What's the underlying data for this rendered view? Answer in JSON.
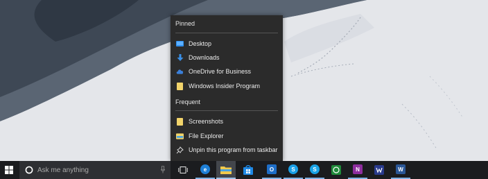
{
  "jumplist": {
    "pinned_label": "Pinned",
    "frequent_label": "Frequent",
    "pinned": [
      {
        "label": "Desktop",
        "icon": "desktop-folder-icon",
        "color": "#2f8ff0"
      },
      {
        "label": "Downloads",
        "icon": "downloads-icon",
        "color": "#3a8fe6"
      },
      {
        "label": "OneDrive for Business",
        "icon": "onedrive-icon",
        "color": "#3b7fd9"
      },
      {
        "label": "Windows Insider Program",
        "icon": "folder-icon",
        "color": "#f2d46b"
      }
    ],
    "frequent": [
      {
        "label": "Screenshots",
        "icon": "folder-icon",
        "color": "#f2d46b"
      },
      {
        "label": "File Explorer",
        "icon": "file-explorer-icon",
        "color": "#f2d46b"
      }
    ],
    "unpin_label": "Unpin this program from taskbar"
  },
  "taskbar": {
    "search_placeholder": "Ask me anything",
    "apps": [
      {
        "name": "task-view",
        "icon": "task-view-icon"
      },
      {
        "name": "edge",
        "icon": "edge-icon",
        "color": "#1e7fd6",
        "glyph": "e"
      },
      {
        "name": "file-explorer",
        "icon": "file-explorer-icon",
        "color": "#f2c94c"
      },
      {
        "name": "store",
        "icon": "store-icon",
        "color": "#1e88e5"
      },
      {
        "name": "outlook",
        "icon": "outlook-icon",
        "color": "#1e6ec8",
        "glyph": "O"
      },
      {
        "name": "skype-business",
        "icon": "skype-icon",
        "color": "#1aa0e8",
        "glyph": "S"
      },
      {
        "name": "skype",
        "icon": "skype-icon",
        "color": "#18a3e6",
        "glyph": "S"
      },
      {
        "name": "xbox",
        "icon": "xbox-icon",
        "color": "#1f8a3a"
      },
      {
        "name": "onenote",
        "icon": "onenote-icon",
        "color": "#8e2d9e",
        "glyph": "N"
      },
      {
        "name": "app-blue",
        "icon": "app-icon",
        "color": "#2a3a8c"
      },
      {
        "name": "word",
        "icon": "word-icon",
        "color": "#2b5797",
        "glyph": "W"
      }
    ]
  }
}
